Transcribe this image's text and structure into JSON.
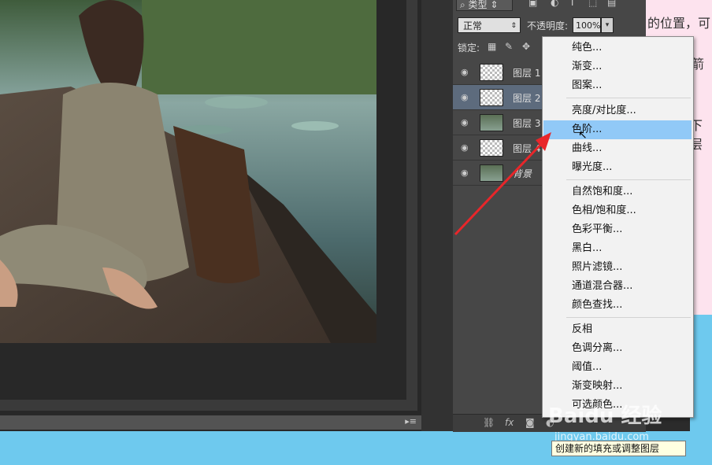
{
  "background_text": [
    "的位置，可",
    "箭",
    "下层"
  ],
  "layers_panel": {
    "filter_label": "类型",
    "blend_mode": "正常",
    "opacity_label": "不透明度:",
    "opacity_value": "100%",
    "lock_label": "锁定:",
    "layers": [
      {
        "name": "图层 1",
        "thumb": "figure",
        "selected": false
      },
      {
        "name": "图层 2",
        "thumb": "figure",
        "selected": true
      },
      {
        "name": "图层 3",
        "thumb": "photo",
        "selected": false
      },
      {
        "name": "图层 4",
        "thumb": "transparent",
        "selected": false
      },
      {
        "name": "背景",
        "thumb": "photo",
        "selected": false
      }
    ]
  },
  "menu": {
    "items": [
      {
        "label": "纯色..."
      },
      {
        "label": "渐变..."
      },
      {
        "label": "图案..."
      },
      {
        "label": "亮度/对比度..."
      },
      {
        "label": "色阶...",
        "highlighted": true
      },
      {
        "label": "曲线..."
      },
      {
        "label": "曝光度..."
      },
      {
        "label": "自然饱和度..."
      },
      {
        "label": "色相/饱和度..."
      },
      {
        "label": "色彩平衡..."
      },
      {
        "label": "黑白..."
      },
      {
        "label": "照片滤镜..."
      },
      {
        "label": "通道混合器..."
      },
      {
        "label": "颜色查找..."
      },
      {
        "label": "反相"
      },
      {
        "label": "色调分离..."
      },
      {
        "label": "阈值..."
      },
      {
        "label": "渐变映射..."
      },
      {
        "label": "可选颜色..."
      }
    ]
  },
  "tooltip": "创建新的填充或调整图层",
  "watermark": {
    "brand": "Baidu 经验",
    "url": "jingyan.baidu.com"
  },
  "colors": {
    "highlight": "#91c9f7",
    "arrow": "#e8262a",
    "panel": "#474747",
    "canvas": "#282828"
  }
}
